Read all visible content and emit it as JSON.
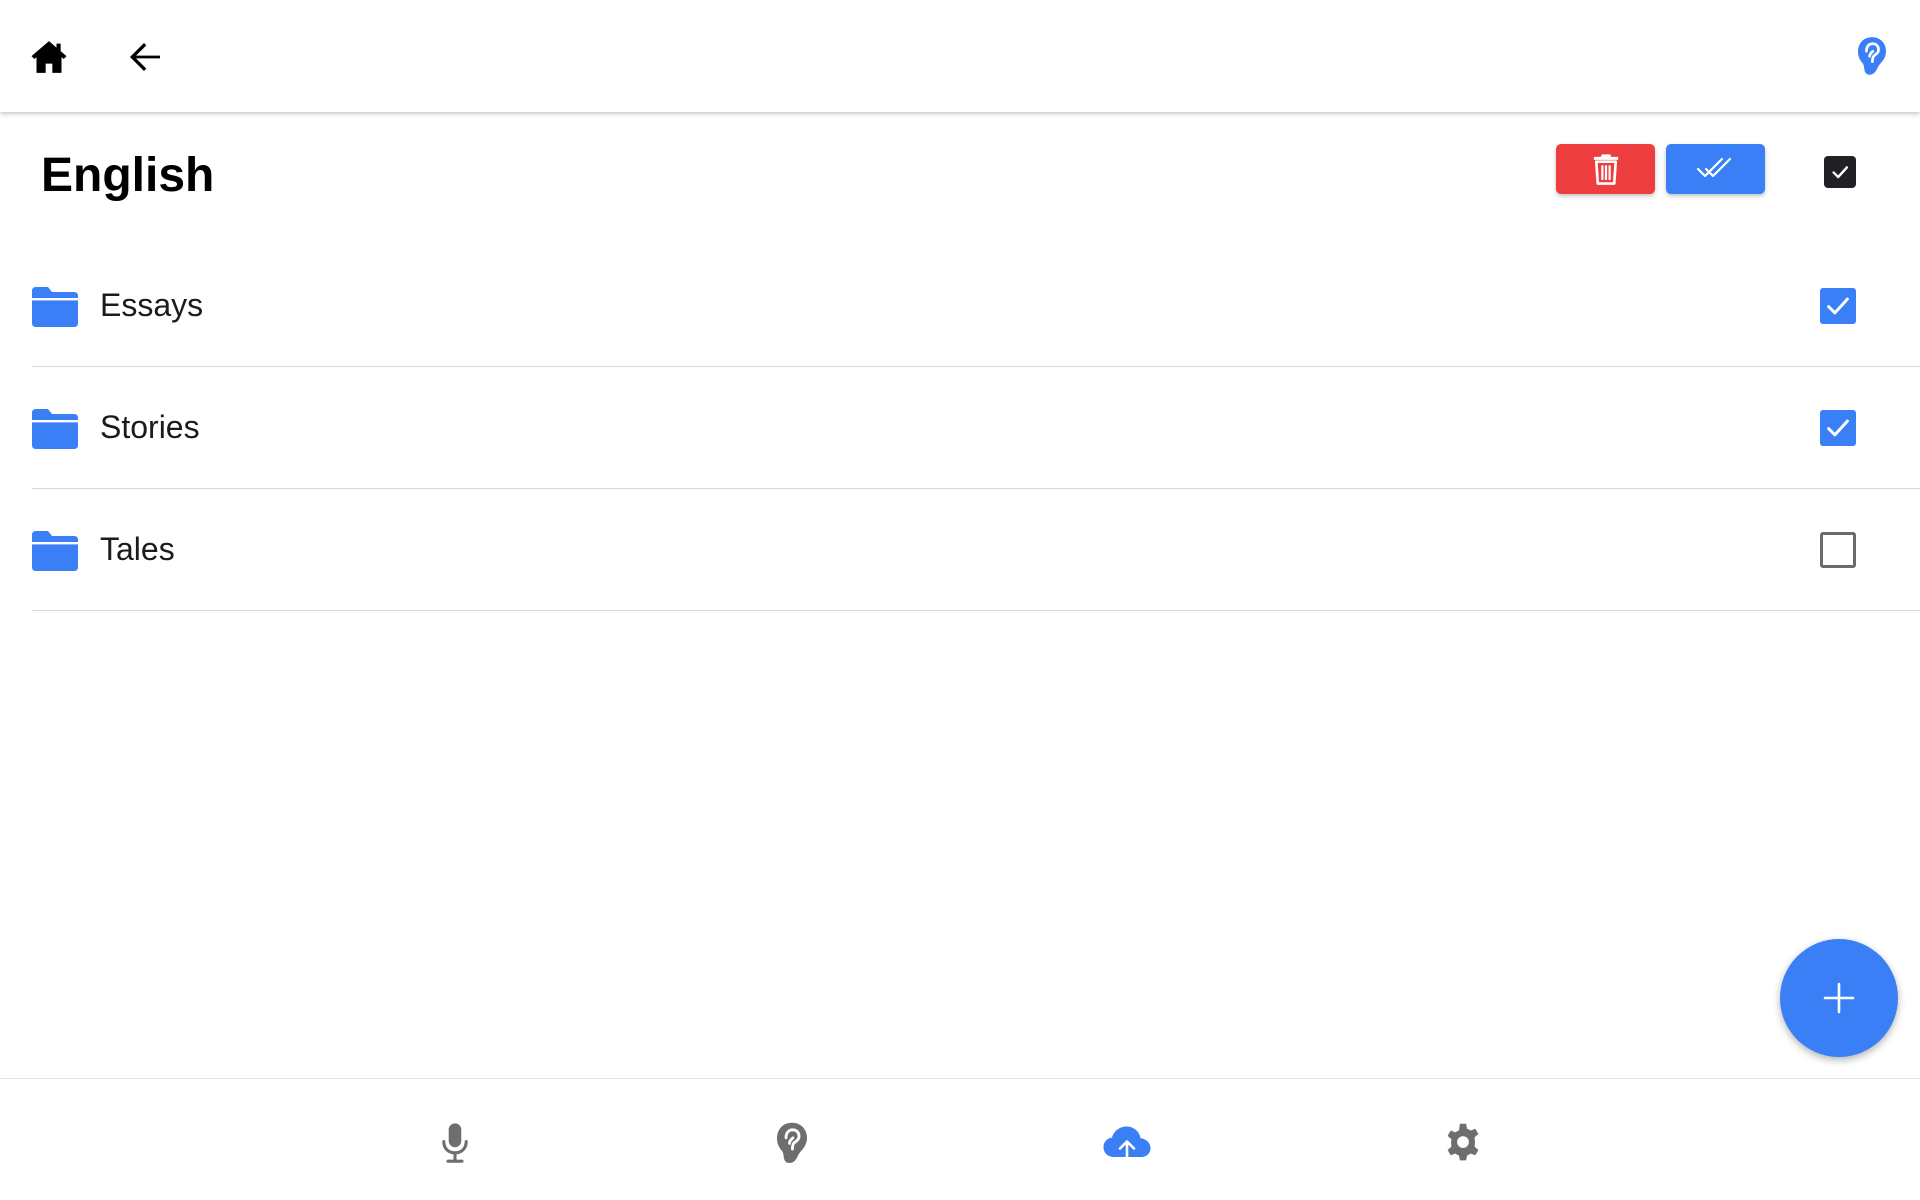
{
  "header": {
    "icons": {
      "home": "home-icon",
      "back": "arrow-back-icon",
      "listen": "ear-icon"
    }
  },
  "page": {
    "title": "English"
  },
  "toolbar": {
    "delete_icon": "trash-icon",
    "mark_all_icon": "double-check-icon",
    "select_all_checked": true
  },
  "folders": [
    {
      "label": "Essays",
      "checked": true
    },
    {
      "label": "Stories",
      "checked": true
    },
    {
      "label": "Tales",
      "checked": false
    }
  ],
  "fab": {
    "icon": "plus-icon"
  },
  "bottom_nav": {
    "items": [
      {
        "icon": "microphone-icon",
        "active": false
      },
      {
        "icon": "ear-icon",
        "active": false
      },
      {
        "icon": "cloud-upload-icon",
        "active": true
      },
      {
        "icon": "gear-icon",
        "active": false
      }
    ]
  },
  "colors": {
    "accent": "#3a7ff6",
    "danger": "#ee3d3e",
    "inactive_icon": "#6e6e6e",
    "text": "#1b1b1b"
  }
}
